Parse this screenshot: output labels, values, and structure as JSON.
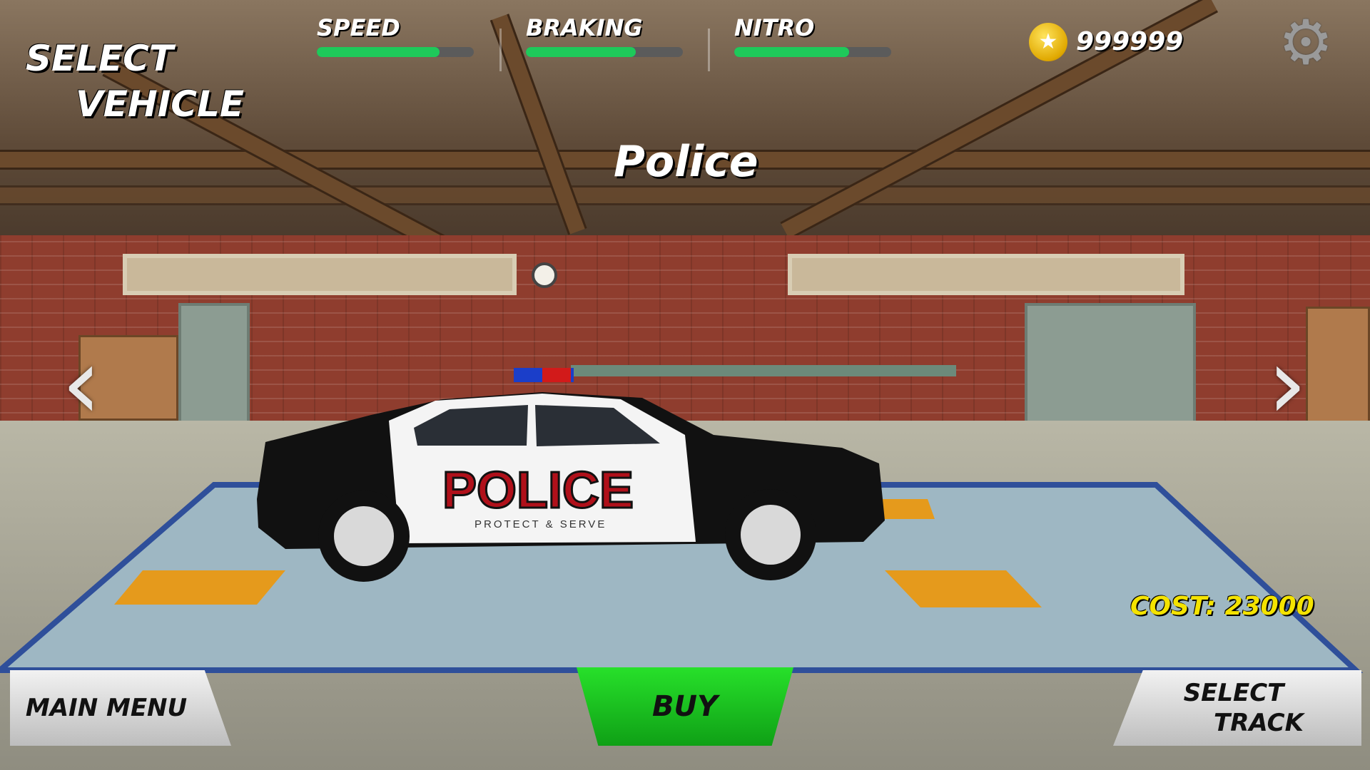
{
  "header": {
    "title_line1": "SELECT",
    "title_line2": "VEHICLE"
  },
  "stats": [
    {
      "label": "SPEED",
      "value": 0.78
    },
    {
      "label": "BRAKING",
      "value": 0.7
    },
    {
      "label": "NITRO",
      "value": 0.73
    }
  ],
  "currency": {
    "icon": "coin-star-icon",
    "amount": "999999"
  },
  "settings": {
    "icon": "gear-icon"
  },
  "vehicle": {
    "name": "Police",
    "livery_text": "POLICE",
    "livery_subtext": "PROTECT & SERVE",
    "cost_text": "COST: 23000"
  },
  "navigation": {
    "prev_icon": "chevron-left-icon",
    "next_icon": "chevron-right-icon"
  },
  "buttons": {
    "main_menu": "MAIN MENU",
    "buy": "BUY",
    "select_track_line1": "SELECT",
    "select_track_line2": "TRACK"
  },
  "colors": {
    "bar_fill": "#1ec95a",
    "buy_button": "#1fc925",
    "cost_text": "#f4e300"
  }
}
